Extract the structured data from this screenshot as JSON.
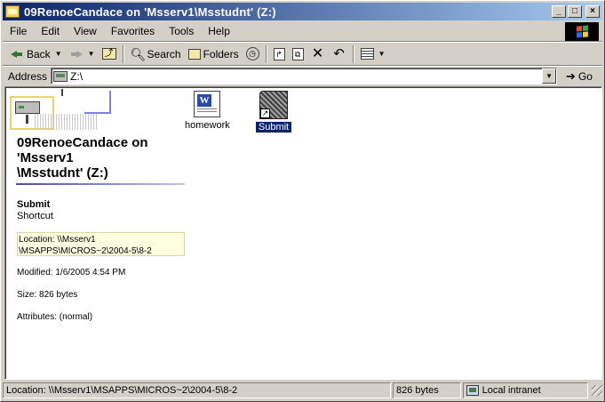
{
  "window": {
    "title": "09RenoeCandace on 'Msserv1\\Msstudnt' (Z:)",
    "controls": {
      "minimize": "_",
      "maximize": "□",
      "close": "×"
    }
  },
  "menu": [
    "File",
    "Edit",
    "View",
    "Favorites",
    "Tools",
    "Help"
  ],
  "toolbar": {
    "back_label": "Back",
    "search_label": "Search",
    "folders_label": "Folders"
  },
  "address": {
    "label": "Address",
    "value": "Z:\\",
    "go_label": "Go"
  },
  "folder_panel": {
    "title_line1": "09RenoeCandace on",
    "title_line2": "'Msserv1",
    "title_line3": "\\Msstudnt' (Z:)",
    "selected_name": "Submit",
    "selected_type": "Shortcut",
    "location_line1": "Location: \\\\Msserv1",
    "location_line2": "\\MSAPPS\\MICROS~2\\2004-5\\8-2",
    "modified": "Modified: 1/6/2005 4:54 PM",
    "size": "Size: 826 bytes",
    "attributes": "Attributes: (normal)"
  },
  "files": [
    {
      "name": "homework",
      "icon": "word-document-icon",
      "selected": false
    },
    {
      "name": "Submit",
      "icon": "shortcut-icon",
      "selected": true
    }
  ],
  "status": {
    "location": "Location: \\\\Msserv1\\MSAPPS\\MICROS~2\\2004-5\\8-2",
    "size": "826 bytes",
    "zone": "Local intranet"
  },
  "colors": {
    "titlebar_start": "#0a246a",
    "titlebar_end": "#a6caf0",
    "selection": "#0a246a",
    "window_face": "#d4d0c8"
  }
}
